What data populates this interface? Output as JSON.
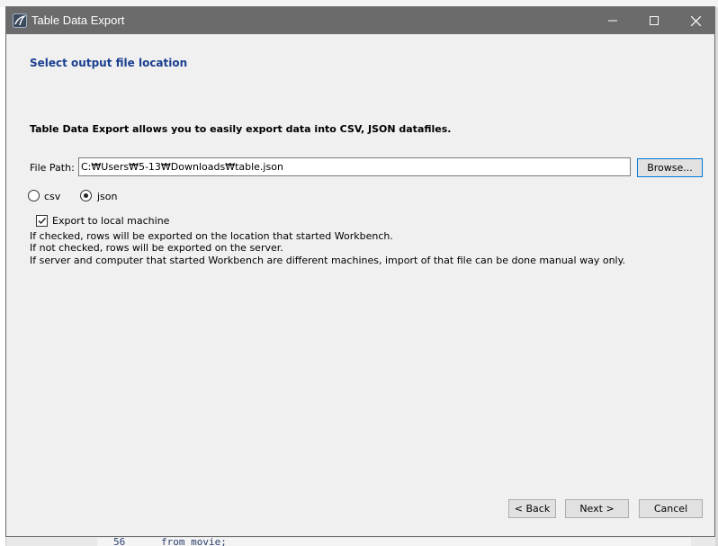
{
  "background": {
    "editor_line_number": "56",
    "editor_code": "from movie;"
  },
  "window": {
    "title": "Table Data Export",
    "app_icon": "mysql-workbench-icon",
    "controls": [
      "minimize-icon",
      "maximize-icon",
      "close-icon"
    ]
  },
  "page": {
    "header": "Select output file location",
    "intro": "Table Data Export allows you to easily export data into CSV, JSON datafiles."
  },
  "file_path": {
    "label": "File Path:",
    "value": "C:₩Users₩5-13₩Downloads₩table.json",
    "browse_label": "Browse..."
  },
  "format": {
    "options": [
      {
        "label": "csv",
        "selected": false
      },
      {
        "label": "json",
        "selected": true
      }
    ]
  },
  "export_local": {
    "label": "Export to local machine",
    "checked": true
  },
  "info_lines": [
    "If checked, rows will be exported on the location that started Workbench.",
    "If not checked, rows will be exported on the server.",
    "If server and computer that started Workbench are different machines, import of that file can be done manual way only."
  ],
  "buttons": {
    "back": "< Back",
    "next": "Next >",
    "cancel": "Cancel"
  },
  "colors": {
    "titlebar": "#6b6b6b",
    "header_text": "#1b3f8f",
    "focus_border": "#0078d7"
  }
}
